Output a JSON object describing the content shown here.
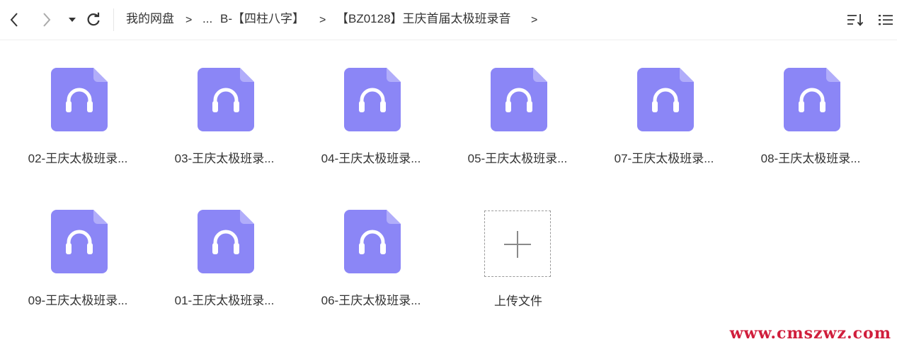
{
  "toolbar": {
    "back_icon": "chevron-left-icon",
    "forward_icon": "chevron-right-icon",
    "dropdown_icon": "caret-down-icon",
    "refresh_icon": "refresh-icon",
    "breadcrumb": {
      "root": "我的网盘",
      "ellipsis": "...",
      "level1": "B-【四柱八字】",
      "current": "【BZ0128】王庆首届太极班录音"
    },
    "sort_icon": "sort-icon",
    "view_icon": "list-view-icon"
  },
  "files": [
    {
      "name": "02-王庆太极班录...",
      "icon": "audio-file-icon"
    },
    {
      "name": "03-王庆太极班录...",
      "icon": "audio-file-icon"
    },
    {
      "name": "04-王庆太极班录...",
      "icon": "audio-file-icon"
    },
    {
      "name": "05-王庆太极班录...",
      "icon": "audio-file-icon"
    },
    {
      "name": "07-王庆太极班录...",
      "icon": "audio-file-icon"
    },
    {
      "name": "08-王庆太极班录...",
      "icon": "audio-file-icon"
    },
    {
      "name": "09-王庆太极班录...",
      "icon": "audio-file-icon"
    },
    {
      "name": "01-王庆太极班录...",
      "icon": "audio-file-icon"
    },
    {
      "name": "06-王庆太极班录...",
      "icon": "audio-file-icon"
    }
  ],
  "upload": {
    "label": "上传文件",
    "icon": "plus-icon"
  },
  "watermark": "www.cmszwz.com",
  "colors": {
    "file_icon": "#8b86f6",
    "file_icon_fold": "#b1adfa",
    "watermark": "#d01e3c"
  }
}
